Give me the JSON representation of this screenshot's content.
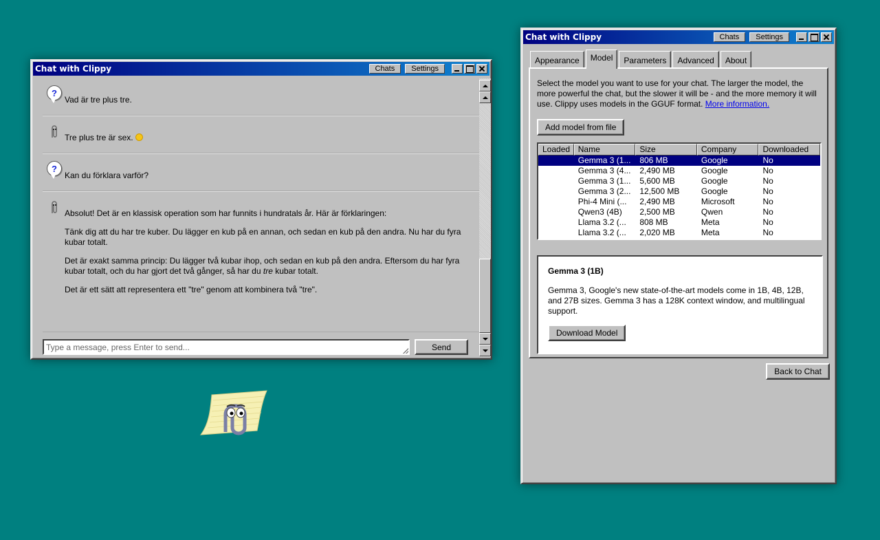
{
  "chat_window": {
    "title": "Chat with Clippy",
    "chats_label": "Chats",
    "settings_label": "Settings",
    "messages": [
      {
        "role": "user",
        "icon": "question-bubble-icon",
        "text": "Vad är tre plus tre."
      },
      {
        "role": "assistant",
        "icon": "paperclip-icon",
        "text": "Tre plus tre är sex."
      },
      {
        "role": "user",
        "icon": "question-bubble-icon",
        "text": "Kan du förklara varför?"
      },
      {
        "role": "assistant",
        "icon": "paperclip-icon",
        "p1": "Absolut! Det är en klassisk operation som har funnits i hundratals år. Här är förklaringen:",
        "p2": "Tänk dig att du har tre kuber. Du lägger en kub på en annan, och sedan en kub på den andra. Nu har du fyra kubar totalt.",
        "p3_a": "Det är exakt samma princip: Du lägger två kubar ihop, och sedan en kub på den andra. Eftersom du har fyra kubar totalt, och du har gjort det två gånger, så har du ",
        "p3_em": "tre",
        "p3_b": " kubar totalt.",
        "p4": "Det är ett sätt att representera ett \"tre\" genom att kombinera två \"tre\"."
      }
    ],
    "input_placeholder": "Type a message, press Enter to send...",
    "send_label": "Send"
  },
  "settings_window": {
    "title": "Chat with Clippy",
    "chats_label": "Chats",
    "settings_label": "Settings",
    "tabs": [
      {
        "label": "Appearance",
        "active": false
      },
      {
        "label": "Model",
        "active": true
      },
      {
        "label": "Parameters",
        "active": false
      },
      {
        "label": "Advanced",
        "active": false
      },
      {
        "label": "About",
        "active": false
      }
    ],
    "description": "Select the model you want to use for your chat. The larger the model, the more powerful the chat, but the slower it will be - and the more memory it will use. Clippy uses models in the GGUF format.",
    "more_info_link": "More information.",
    "add_model_label": "Add model from file",
    "columns": [
      "Loaded",
      "Name",
      "Size",
      "Company",
      "Downloaded"
    ],
    "models": [
      {
        "loaded": "",
        "name": "Gemma 3 (1...",
        "size": "806 MB",
        "company": "Google",
        "downloaded": "No",
        "selected": true
      },
      {
        "loaded": "",
        "name": "Gemma 3 (4...",
        "size": "2,490 MB",
        "company": "Google",
        "downloaded": "No",
        "selected": false
      },
      {
        "loaded": "",
        "name": "Gemma 3 (1...",
        "size": "5,600 MB",
        "company": "Google",
        "downloaded": "No",
        "selected": false
      },
      {
        "loaded": "",
        "name": "Gemma 3 (2...",
        "size": "12,500 MB",
        "company": "Google",
        "downloaded": "No",
        "selected": false
      },
      {
        "loaded": "",
        "name": "Phi-4 Mini (...",
        "size": "2,490 MB",
        "company": "Microsoft",
        "downloaded": "No",
        "selected": false
      },
      {
        "loaded": "",
        "name": "Qwen3 (4B)",
        "size": "2,500 MB",
        "company": "Qwen",
        "downloaded": "No",
        "selected": false
      },
      {
        "loaded": "",
        "name": "Llama 3.2 (...",
        "size": "808 MB",
        "company": "Meta",
        "downloaded": "No",
        "selected": false
      },
      {
        "loaded": "",
        "name": "Llama 3.2 (...",
        "size": "2,020 MB",
        "company": "Meta",
        "downloaded": "No",
        "selected": false
      }
    ],
    "details": {
      "title": "Gemma 3 (1B)",
      "description": "Gemma 3, Google's new state-of-the-art models come in 1B, 4B, 12B, and 27B sizes. Gemma 3 has a 128K context window, and multilingual support.",
      "download_label": "Download Model"
    },
    "back_label": "Back to Chat"
  },
  "colors": {
    "desktop": "#008080",
    "title_start": "#000080",
    "title_end": "#1084d0",
    "selection": "#000080",
    "face": "#c0c0c0"
  }
}
